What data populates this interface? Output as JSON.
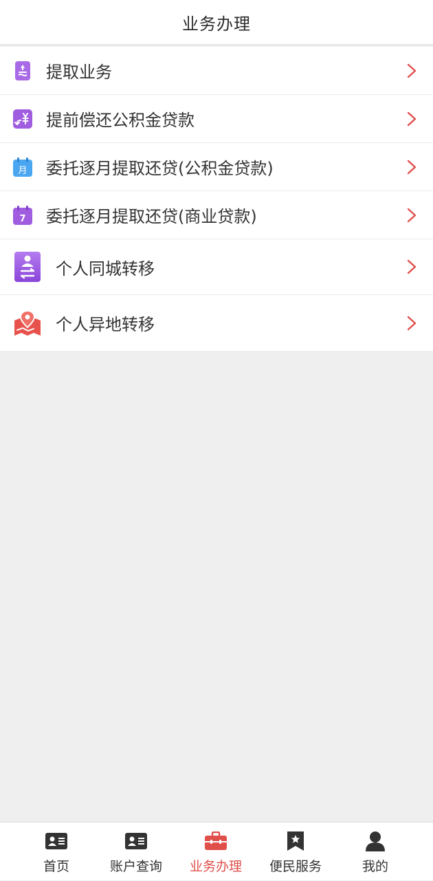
{
  "header": {
    "title": "业务办理"
  },
  "list": {
    "items": [
      {
        "label": "提取业务",
        "icon": "withdraw-icon"
      },
      {
        "label": "提前偿还公积金贷款",
        "icon": "repay-yuan-icon"
      },
      {
        "label": "委托逐月提取还贷(公积金贷款)",
        "icon": "calendar-month-icon"
      },
      {
        "label": "委托逐月提取还贷(商业贷款)",
        "icon": "calendar-7-icon"
      },
      {
        "label": "个人同城转移",
        "icon": "person-transfer-icon"
      },
      {
        "label": "个人异地转移",
        "icon": "map-location-icon"
      }
    ]
  },
  "tabbar": {
    "items": [
      {
        "label": "首页",
        "icon": "id-card-icon",
        "active": false
      },
      {
        "label": "账户查询",
        "icon": "id-card-icon",
        "active": false
      },
      {
        "label": "业务办理",
        "icon": "briefcase-icon",
        "active": true
      },
      {
        "label": "便民服务",
        "icon": "star-bookmark-icon",
        "active": false
      },
      {
        "label": "我的",
        "icon": "user-icon",
        "active": false
      }
    ]
  },
  "colors": {
    "accent": "#e04f4a",
    "icon_purple": "#a05de0",
    "icon_blue": "#4aa6f0",
    "icon_red": "#e8524c"
  }
}
